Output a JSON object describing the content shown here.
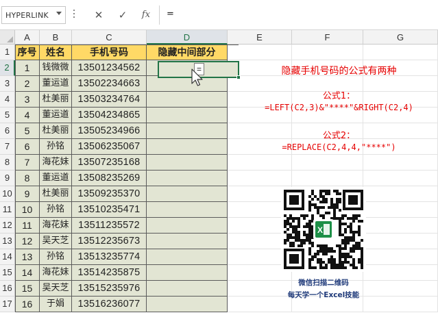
{
  "formula_bar": {
    "name_box": "HYPERLINK",
    "cancel_glyph": "✕",
    "enter_glyph": "✓",
    "fx_label": "fx",
    "formula": "="
  },
  "columns": [
    "A",
    "B",
    "C",
    "D",
    "E",
    "F",
    "G"
  ],
  "rows": [
    "1",
    "2",
    "3",
    "4",
    "5",
    "6",
    "7",
    "8",
    "9",
    "10",
    "11",
    "12",
    "13",
    "14",
    "15",
    "16",
    "17"
  ],
  "active_cell": {
    "ref": "D2",
    "editing_text": "="
  },
  "table": {
    "headers": [
      "序号",
      "姓名",
      "手机号码",
      "隐藏中间部分"
    ],
    "rows": [
      [
        "1",
        "钱微微",
        "13501234562",
        ""
      ],
      [
        "2",
        "董运道",
        "13502234663",
        ""
      ],
      [
        "3",
        "杜美丽",
        "13503234764",
        ""
      ],
      [
        "4",
        "董运道",
        "13504234865",
        ""
      ],
      [
        "5",
        "杜美丽",
        "13505234966",
        ""
      ],
      [
        "6",
        "孙铭",
        "13506235067",
        ""
      ],
      [
        "7",
        "海花妹",
        "13507235168",
        ""
      ],
      [
        "8",
        "董运道",
        "13508235269",
        ""
      ],
      [
        "9",
        "杜美丽",
        "13509235370",
        ""
      ],
      [
        "10",
        "孙铭",
        "13510235471",
        ""
      ],
      [
        "11",
        "海花妹",
        "13511235572",
        ""
      ],
      [
        "12",
        "吴天芝",
        "13512235673",
        ""
      ],
      [
        "13",
        "孙铭",
        "13513235774",
        ""
      ],
      [
        "14",
        "海花妹",
        "13514235875",
        ""
      ],
      [
        "15",
        "吴天芝",
        "13515235976",
        ""
      ],
      [
        "16",
        "于娟",
        "13516236077",
        ""
      ]
    ]
  },
  "notes": {
    "title": "隐藏手机号码的公式有两种",
    "formula1_label": "公式1：",
    "formula1": "=LEFT(C2,3)&\"****\"&RIGHT(C2,4)",
    "formula2_label": "公式2：",
    "formula2": "=REPLACE(C2,4,4,\"****\")"
  },
  "qr": {
    "caption1": "微信扫描二维码",
    "caption2": "每天学一个Excel技能",
    "badge_letter": "X"
  },
  "colors": {
    "header_fill": "#ffd966",
    "body_fill": "#e2e5d3",
    "accent_green": "#217346",
    "note_red": "#e60000",
    "caption_blue": "#1f3a7a"
  }
}
